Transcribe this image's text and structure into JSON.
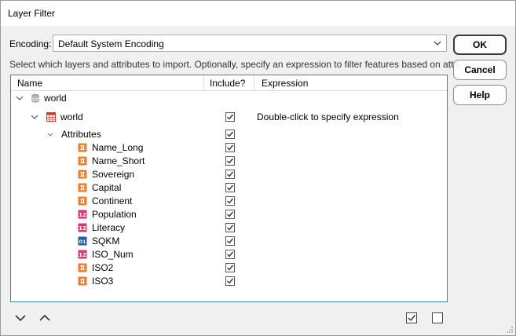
{
  "window": {
    "title": "Layer Filter"
  },
  "encoding": {
    "label": "Encoding:",
    "value": "Default System Encoding"
  },
  "description": "Select which layers and attributes to import. Optionally, specify an expression to filter features based on attributes.",
  "buttons": {
    "ok": "OK",
    "cancel": "Cancel",
    "help": "Help"
  },
  "tree": {
    "columns": {
      "name": "Name",
      "include": "Include?",
      "expression": "Expression"
    },
    "root": {
      "label": "world",
      "icon": "database-icon"
    },
    "layer": {
      "label": "world",
      "icon": "table-icon",
      "include": true,
      "expression": "Double-click to specify expression"
    },
    "attributes_group": {
      "label": "Attributes",
      "include": true
    },
    "attributes": [
      {
        "name": "Name_Long",
        "type": "string",
        "include": true
      },
      {
        "name": "Name_Short",
        "type": "string",
        "include": true
      },
      {
        "name": "Sovereign",
        "type": "string",
        "include": true
      },
      {
        "name": "Capital",
        "type": "string",
        "include": true
      },
      {
        "name": "Continent",
        "type": "string",
        "include": true
      },
      {
        "name": "Population",
        "type": "integer",
        "include": true
      },
      {
        "name": "Literacy",
        "type": "integer",
        "include": true
      },
      {
        "name": "SQKM",
        "type": "real",
        "include": true
      },
      {
        "name": "ISO_Num",
        "type": "integer",
        "include": true
      },
      {
        "name": "ISO2",
        "type": "string",
        "include": true
      },
      {
        "name": "ISO3",
        "type": "string",
        "include": true
      }
    ]
  },
  "footer": {
    "move_down_icon": "chevron-down-icon",
    "move_up_icon": "chevron-up-icon",
    "check_all_icon": "check-all-icon",
    "uncheck_all_icon": "uncheck-all-icon"
  },
  "colors": {
    "accent_border": "#3c7fb1",
    "string_icon": "#f07c2e",
    "integer_icon": "#e0346e",
    "real_icon": "#1f5fa8",
    "table_icon": "#d9342b"
  }
}
